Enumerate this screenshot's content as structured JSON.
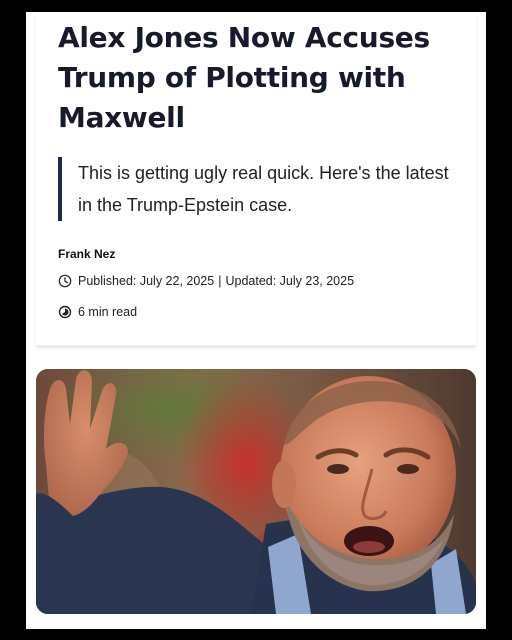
{
  "article": {
    "headline": "Alex Jones Now Accuses Trump of Plotting with Maxwell",
    "subheadline": "This is getting ugly real quick. Here's the latest in the Trump-Epstein case.",
    "author": "Frank Nez",
    "published": "Published: July 22, 2025",
    "separator": "|",
    "updated": "Updated: July 23, 2025",
    "read_time": "6 min read",
    "icons": {
      "published": "clock-icon",
      "read_time": "reading-progress-icon"
    },
    "colors": {
      "headline": "#151a2d",
      "quote_bar": "#1c2b4b",
      "text": "#222222"
    }
  },
  "photo": {
    "subject": "man with beard shouting, hand raised"
  }
}
